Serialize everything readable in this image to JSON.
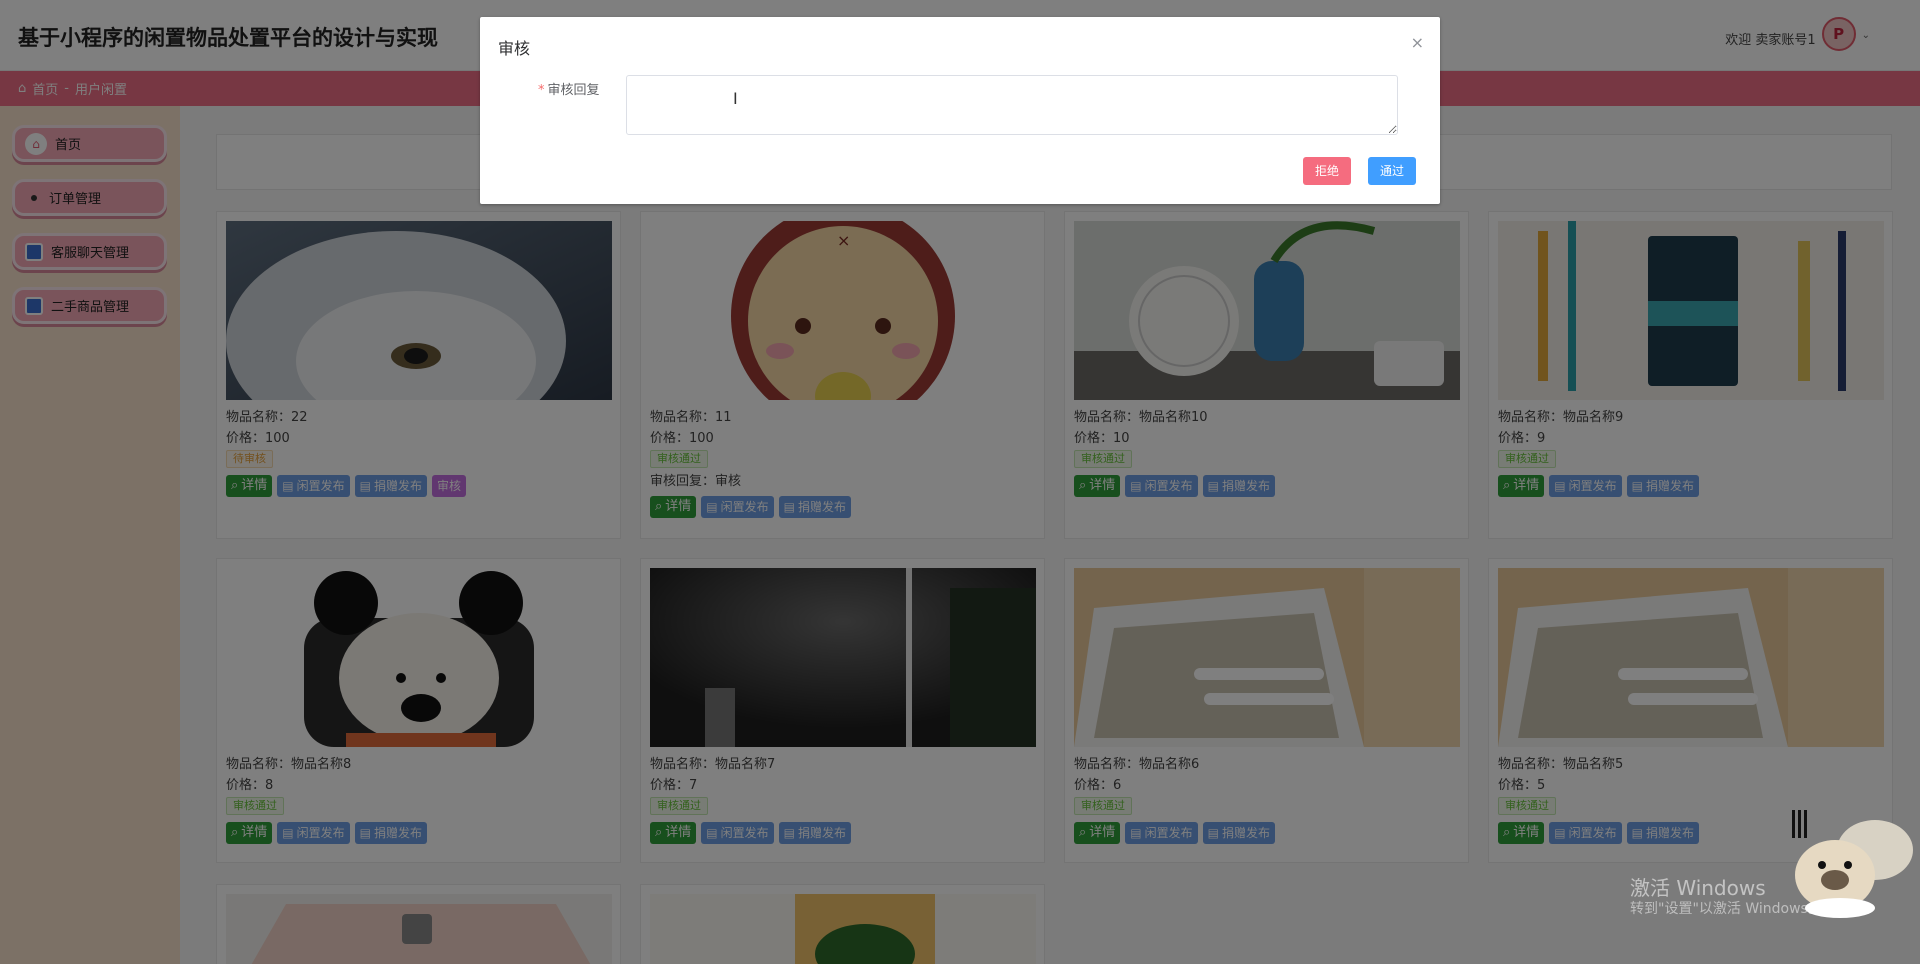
{
  "header": {
    "title": "基于小程序的闲置物品处置平台的设计与实现",
    "welcome": "欢迎 卖家账号1",
    "avatar_initial": "P"
  },
  "breadcrumb": {
    "home": "首页",
    "separator": "-",
    "current": "用户闲置"
  },
  "sidebar": {
    "items": [
      {
        "label": "首页"
      },
      {
        "label": "订单管理"
      },
      {
        "label": "客服聊天管理"
      },
      {
        "label": "二手商品管理"
      }
    ]
  },
  "labels": {
    "name": "物品名称：",
    "price": "价格：",
    "reply": "审核回复："
  },
  "buttons": {
    "detail": "详情",
    "idle": "闲置发布",
    "donate": "捐赠发布",
    "audit": "审核"
  },
  "cards": [
    {
      "name": "22",
      "price": "100",
      "status": "待审核",
      "reply": ""
    },
    {
      "name": "11",
      "price": "100",
      "status": "审核通过",
      "reply": "审核"
    },
    {
      "name": "物品名称10",
      "price": "10",
      "status": "审核通过",
      "reply": ""
    },
    {
      "name": "物品名称9",
      "price": "9",
      "status": "审核通过",
      "reply": ""
    },
    {
      "name": "物品名称8",
      "price": "8",
      "status": "审核通过",
      "reply": ""
    },
    {
      "name": "物品名称7",
      "price": "7",
      "status": "审核通过",
      "reply": ""
    },
    {
      "name": "物品名称6",
      "price": "6",
      "status": "审核通过",
      "reply": ""
    },
    {
      "name": "物品名称5",
      "price": "5",
      "status": "审核通过",
      "reply": ""
    }
  ],
  "dialog": {
    "title": "审核",
    "close": "×",
    "required": "*",
    "field_label": "审核回复",
    "field_value": "",
    "reject": "拒绝",
    "pass": "通过"
  },
  "watermark": {
    "line1": "激活 Windows",
    "line2": "转到\"设置\"以激活 Windows。"
  },
  "colors": {
    "nav_pink": "#ef6f86",
    "sidebar_bg": "#f9e3cc",
    "pass_blue": "#409eff",
    "reject_red": "#f56c7f",
    "detail_green": "#2f9e3a"
  }
}
